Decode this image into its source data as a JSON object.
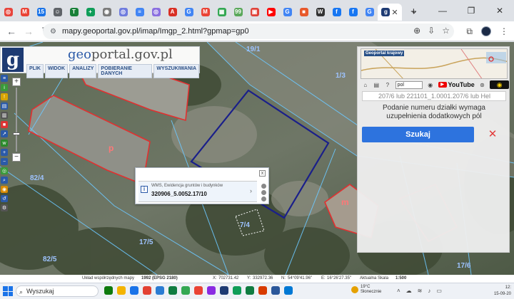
{
  "browser": {
    "tabs": [
      {
        "icon": "tab-favicon-1",
        "color": "#e8453c",
        "glyph": "◎"
      },
      {
        "icon": "gmail-icon",
        "color": "#ea4335",
        "glyph": "M"
      },
      {
        "icon": "calendar-icon",
        "color": "#1a73e8",
        "glyph": "15"
      },
      {
        "icon": "tab-favicon-4",
        "color": "#5f6368",
        "glyph": "☺"
      },
      {
        "icon": "tab-favicon-5",
        "color": "#188038",
        "glyph": "T"
      },
      {
        "icon": "tab-favicon-6",
        "color": "#0f9d58",
        "glyph": "+"
      },
      {
        "icon": "tab-favicon-7",
        "color": "#7b7b7b",
        "glyph": "◉"
      },
      {
        "icon": "tab-favicon-8",
        "color": "#6f7cde",
        "glyph": "◎"
      },
      {
        "icon": "docs-icon",
        "color": "#4285f4",
        "glyph": "≡"
      },
      {
        "icon": "tab-favicon-10",
        "color": "#8a6fe0",
        "glyph": "◎"
      },
      {
        "icon": "pdf-icon",
        "color": "#d93025",
        "glyph": "A"
      },
      {
        "icon": "google-icon",
        "color": "#4285f4",
        "glyph": "G"
      },
      {
        "icon": "gmail-icon-2",
        "color": "#ea4335",
        "glyph": "M"
      },
      {
        "icon": "sheets-icon",
        "color": "#34a853",
        "glyph": "▦"
      },
      {
        "icon": "tab-favicon-15",
        "color": "#5aa85a",
        "glyph": "99"
      },
      {
        "icon": "tab-favicon-16",
        "color": "#e0433a",
        "glyph": "▣"
      },
      {
        "icon": "youtube-icon",
        "color": "#ff0000",
        "glyph": "▶"
      },
      {
        "icon": "google-icon-2",
        "color": "#4285f4",
        "glyph": "G"
      },
      {
        "icon": "tab-favicon-19",
        "color": "#e8592b",
        "glyph": "■"
      },
      {
        "icon": "wikipedia-icon",
        "color": "#333333",
        "glyph": "W"
      },
      {
        "icon": "facebook-icon",
        "color": "#1877f2",
        "glyph": "f"
      },
      {
        "icon": "facebook-icon-2",
        "color": "#1877f2",
        "glyph": "f"
      },
      {
        "icon": "google-icon-3",
        "color": "#4285f4",
        "glyph": "G"
      },
      {
        "icon": "geoportal-favicon",
        "color": "#1e3b73",
        "glyph": "g",
        "active": true
      }
    ],
    "url": "mapy.geoportal.gov.pl/imap/Imgp_2.html?gpmap=gp0"
  },
  "geoportal": {
    "title_prefix": "geo",
    "title_rest": "portal.gov.pl",
    "menu": [
      "PLIK",
      "WIDOK",
      "ANALIZY",
      "POBIERANIE DANYCH",
      "WYSZUKIWANIA"
    ],
    "overview_title": "Geoportal krajowy",
    "search": {
      "language": "pol",
      "youtube_label": "YouTube",
      "field_text": "207/6 lub 221101_1.0001.207/6 lub Hel",
      "hint": "Podanie numeru działki wymaga uzupełnienia dodatkowych pól",
      "button_label": "Szukaj",
      "clear_label": "✕"
    }
  },
  "map": {
    "parcel_labels": [
      "82/4",
      "7/4",
      "82/5",
      "17/5",
      "17/6",
      "1/3",
      "19/1"
    ],
    "building_labels": [
      "p",
      "m"
    ]
  },
  "popup": {
    "layer": "WMS, Ewidencja gruntów i budynków",
    "parcel_id": "320906_5.0052.17/10",
    "close": "x"
  },
  "statusbar": {
    "crs_label": "Układ współrzędnych mapy",
    "crs_value": "1992 (EPSG 2180)",
    "x_label": "X:",
    "x_value": "702731.42",
    "y_label": "Y:",
    "y_value": "332972.36",
    "n_label": "N:",
    "n_value": "54°09'41.96\"",
    "e_label": "E:",
    "e_value": "16°26'27.35\"",
    "scale_label": "Aktualna Skala",
    "scale_value": "1:500"
  },
  "taskbar": {
    "search_label": "Wyszukaj",
    "apps": [
      "#0e7a0d",
      "#f4b400",
      "#1a73e8",
      "#e34133",
      "#2b7cd3",
      "#107c41",
      "#34a853",
      "#ea4335",
      "#8a2be2",
      "#1e3b73",
      "#0f9d58",
      "#107c41",
      "#d83b01",
      "#2b579a",
      "#0078d4"
    ],
    "weather_temp": "19°C",
    "weather_desc": "Słonecznie",
    "time": "12:",
    "date": "15-09-20"
  }
}
